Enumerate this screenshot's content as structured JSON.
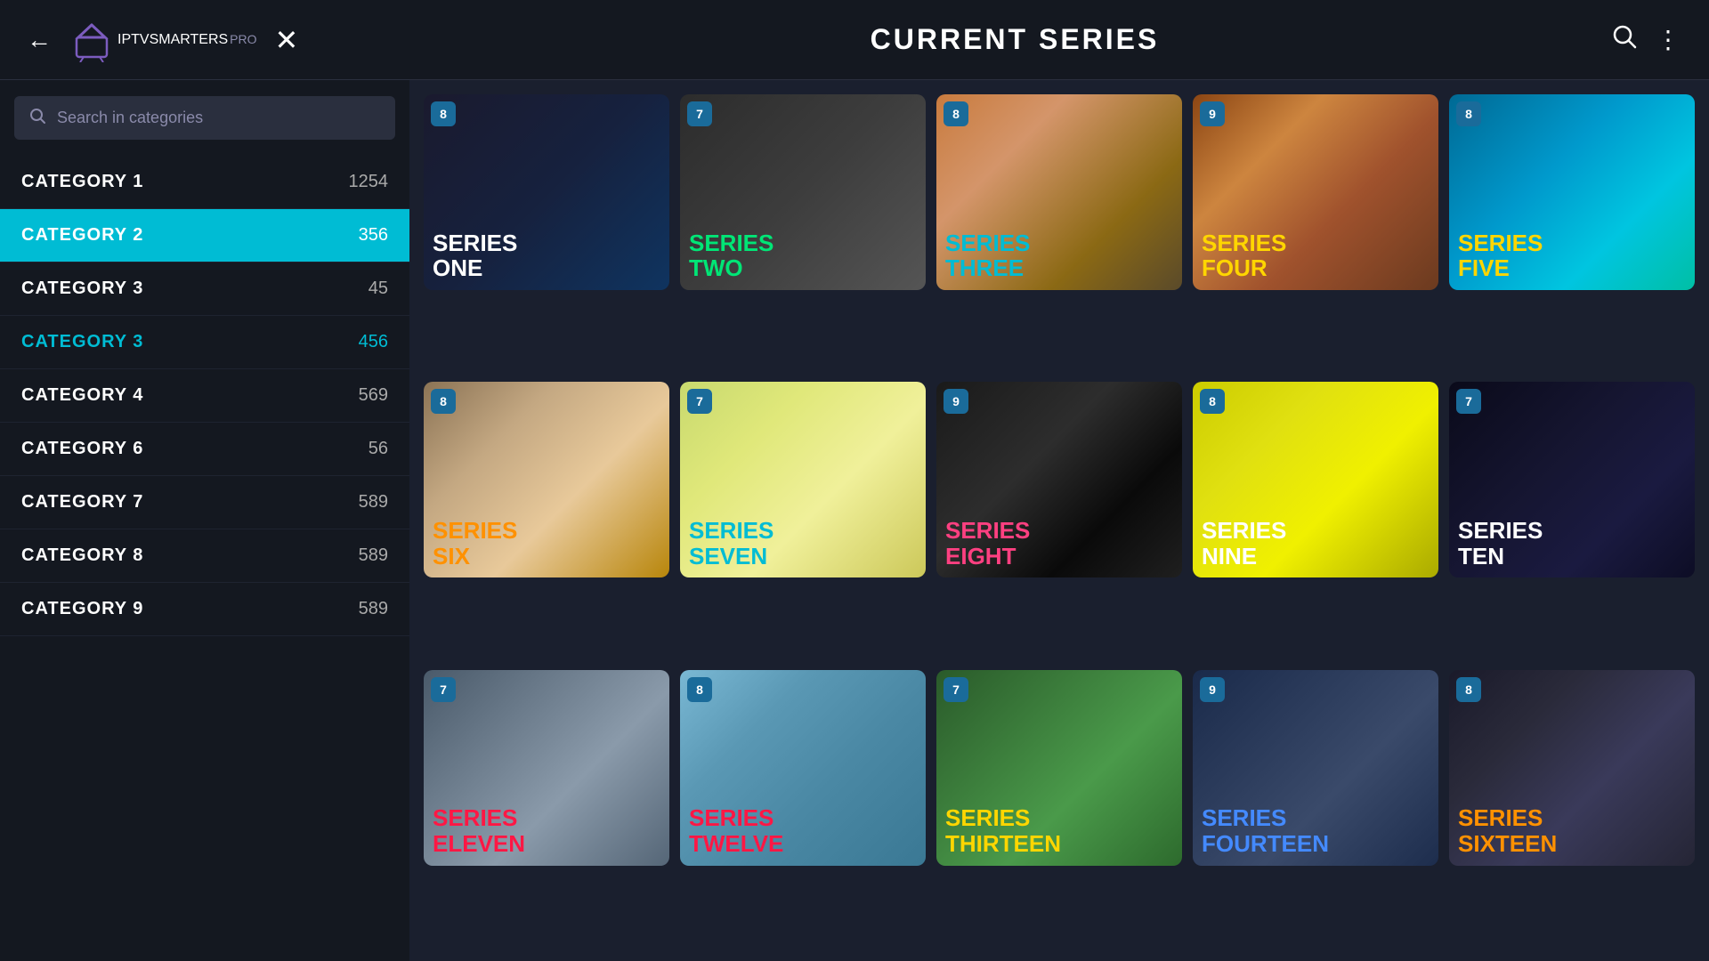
{
  "header": {
    "title": "CURRENT SERIES",
    "logo_iptv": "IPTV",
    "logo_v": "▼",
    "logo_smarters": "SMARTERS",
    "logo_pro": "PRO",
    "back_label": "←",
    "close_label": "✕"
  },
  "sidebar": {
    "search_placeholder": "Search in categories",
    "categories": [
      {
        "name": "CATEGORY  1",
        "count": "1254",
        "active": false,
        "highlight": false
      },
      {
        "name": "CATEGORY  2",
        "count": "356",
        "active": true,
        "highlight": false
      },
      {
        "name": "CATEGORY  3",
        "count": "45",
        "active": false,
        "highlight": false
      },
      {
        "name": "CATEGORY  3",
        "count": "456",
        "active": false,
        "highlight": true
      },
      {
        "name": "CATEGORY  4",
        "count": "569",
        "active": false,
        "highlight": false
      },
      {
        "name": "CATEGORY  6",
        "count": "56",
        "active": false,
        "highlight": false
      },
      {
        "name": "CATEGORY  7",
        "count": "589",
        "active": false,
        "highlight": false
      },
      {
        "name": "CATEGORY  8",
        "count": "589",
        "active": false,
        "highlight": false
      },
      {
        "name": "CATEGORY  9",
        "count": "589",
        "active": false,
        "highlight": false
      }
    ]
  },
  "series": [
    {
      "id": 1,
      "title_line1": "SERIES",
      "title_line2": "ONE",
      "badge": "8",
      "card_class": "card-1",
      "title_color": "title-white"
    },
    {
      "id": 2,
      "title_line1": "SERIES",
      "title_line2": "TWO",
      "badge": "7",
      "card_class": "card-2",
      "title_color": "title-green"
    },
    {
      "id": 3,
      "title_line1": "SERIES",
      "title_line2": "THREE",
      "badge": "8",
      "card_class": "card-3",
      "title_color": "title-cyan"
    },
    {
      "id": 4,
      "title_line1": "SERIES",
      "title_line2": "FOUR",
      "badge": "9",
      "card_class": "card-4",
      "title_color": "title-yellow"
    },
    {
      "id": 5,
      "title_line1": "SERIES",
      "title_line2": "FIVE",
      "badge": "8",
      "card_class": "card-5",
      "title_color": "title-yellow"
    },
    {
      "id": 6,
      "title_line1": "SERIES",
      "title_line2": "SIX",
      "badge": "8",
      "card_class": "card-6",
      "title_color": "title-orange"
    },
    {
      "id": 7,
      "title_line1": "SERIES",
      "title_line2": "SEVEN",
      "badge": "7",
      "card_class": "card-7",
      "title_color": "title-cyan"
    },
    {
      "id": 8,
      "title_line1": "SERIES",
      "title_line2": "EIGHT",
      "badge": "9",
      "card_class": "card-8",
      "title_color": "title-pink"
    },
    {
      "id": 9,
      "title_line1": "SERIES",
      "title_line2": "NINE",
      "badge": "8",
      "card_class": "card-9",
      "title_color": "title-white"
    },
    {
      "id": 10,
      "title_line1": "SERIES",
      "title_line2": "TEN",
      "badge": "7",
      "card_class": "card-10",
      "title_color": "title-white"
    },
    {
      "id": 11,
      "title_line1": "SERIES",
      "title_line2": "ELEVEN",
      "badge": "7",
      "card_class": "card-11",
      "title_color": "title-red"
    },
    {
      "id": 12,
      "title_line1": "SERIES",
      "title_line2": "TWELVE",
      "badge": "8",
      "card_class": "card-12",
      "title_color": "title-red"
    },
    {
      "id": 13,
      "title_line1": "SERIES",
      "title_line2": "THIRTEEN",
      "badge": "7",
      "card_class": "card-13",
      "title_color": "title-yellow"
    },
    {
      "id": 14,
      "title_line1": "SERIES",
      "title_line2": "FOURTEEN",
      "badge": "9",
      "card_class": "card-14",
      "title_color": "title-blue"
    },
    {
      "id": 15,
      "title_line1": "SERIES",
      "title_line2": "SIXTEEN",
      "badge": "8",
      "card_class": "card-15",
      "title_color": "title-orange"
    }
  ]
}
